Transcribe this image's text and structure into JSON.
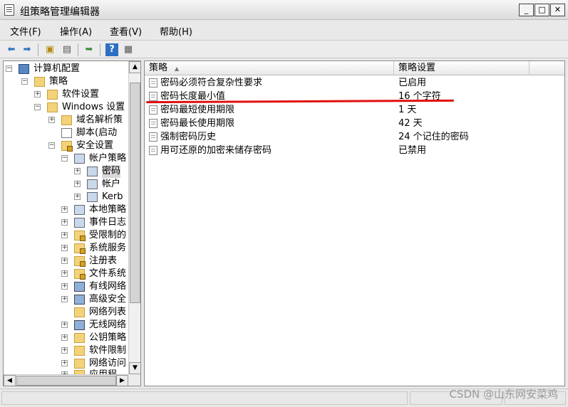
{
  "window": {
    "title": "组策略管理编辑器",
    "minimize": "_",
    "maximize": "□",
    "close": "✕"
  },
  "menu": [
    "文件(F)",
    "操作(A)",
    "查看(V)",
    "帮助(H)"
  ],
  "toolbar": [
    "back-icon",
    "forward-icon",
    "up-folder-icon",
    "show-hide-tree-icon",
    "export-list-icon",
    "help-icon",
    "properties-icon"
  ],
  "tree": {
    "root": "计算机配置",
    "policies": "策略",
    "software_settings": "软件设置",
    "windows_settings": "Windows 设置",
    "dns": "域名解析策",
    "scripts": "脚本(启动",
    "security_settings": "安全设置",
    "account_policies": "帐户策略",
    "password_policy": "密码",
    "account_lockout": "帐户",
    "kerberos": "Kerb",
    "local_policies": "本地策略",
    "event_log": "事件日志",
    "restricted_groups": "受限制的",
    "system_services": "系统服务",
    "registry": "注册表",
    "file_system": "文件系统",
    "wired_network": "有线网络",
    "advanced_security": "高级安全",
    "network_list": "网络列表",
    "wireless_network": "无线网络",
    "public_key": "公钥策略",
    "software_restriction": "软件限制",
    "network_access": "网络访问",
    "app_control": "应用程"
  },
  "list": {
    "col_policy": "策略",
    "col_setting": "策略设置",
    "rows": [
      {
        "name": "密码必须符合复杂性要求",
        "value": "已启用"
      },
      {
        "name": "密码长度最小值",
        "value": "16 个字符"
      },
      {
        "name": "密码最短使用期限",
        "value": "1 天"
      },
      {
        "name": "密码最长使用期限",
        "value": "42 天"
      },
      {
        "name": "强制密码历史",
        "value": "24 个记住的密码"
      },
      {
        "name": "用可还原的加密来储存密码",
        "value": "已禁用"
      }
    ]
  },
  "colors": {
    "annotation": "#e01010"
  },
  "watermark": "CSDN @山东网安菜鸡"
}
